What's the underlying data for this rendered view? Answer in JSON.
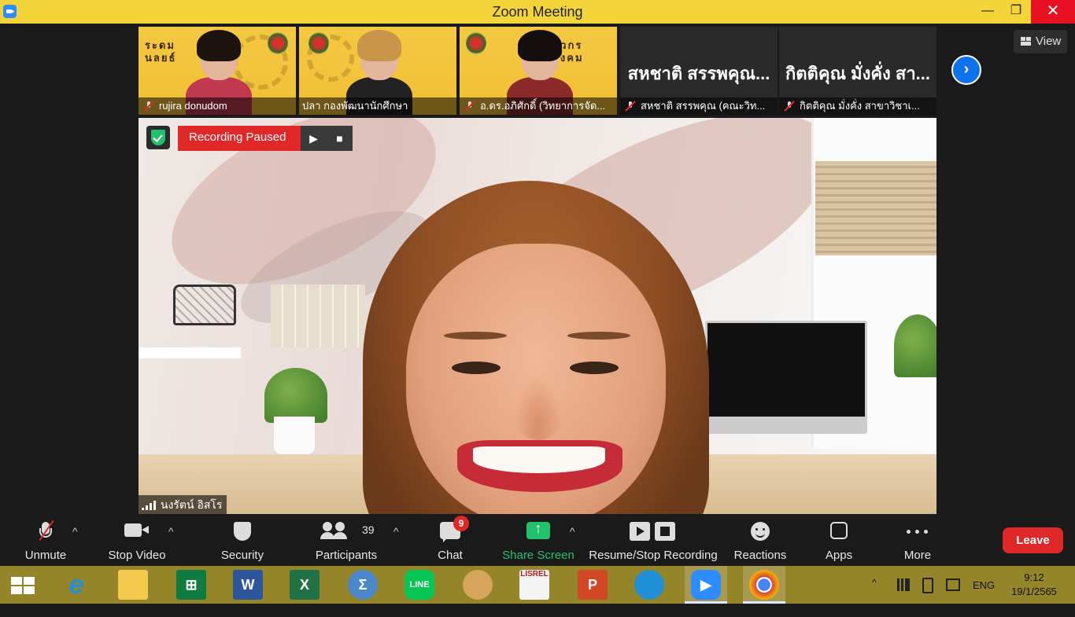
{
  "window": {
    "title": "Zoom Meeting",
    "minimize": "—",
    "maximize": "❐",
    "close": "✕"
  },
  "gallery": {
    "thumbnails": [
      {
        "name": "rujira donudom",
        "video": true,
        "muted": true,
        "text_top": "ระดม\nนลยธ์"
      },
      {
        "name": "ปลา กองพัฒนานักศึกษา",
        "video": true,
        "muted": false
      },
      {
        "name": "อ.ดร.อภิศักดิ์ (วิทยาการจัด...",
        "video": true,
        "muted": true,
        "text_top": "ศวกร\nสังคม"
      },
      {
        "name": "สหชาติ สรรพคุณ (คณะวิท...",
        "display_name": "สหชาติ สรรพคุณ...",
        "video": false,
        "muted": true
      },
      {
        "name": "กิตติคุณ  มั่งคั่ง สาขาวิชาเ...",
        "display_name": "กิตติคุณ  มั่งคั่ง สา...",
        "video": false,
        "muted": true
      }
    ],
    "next_icon": "›",
    "view_label": "View"
  },
  "recording": {
    "status": "Recording Paused",
    "play_icon": "▶",
    "stop_icon": "■"
  },
  "speaker": {
    "name": "นงรัตน์ อิสโร"
  },
  "toolbar": {
    "unmute": "Unmute",
    "stop_video": "Stop Video",
    "security": "Security",
    "participants": "Participants",
    "participants_count": "39",
    "chat": "Chat",
    "chat_badge": "9",
    "share_screen": "Share Screen",
    "recording": "Resume/Stop Recording",
    "reactions": "Reactions",
    "apps": "Apps",
    "more": "More",
    "leave": "Leave",
    "caret": "^",
    "accent_green": "#23c16b",
    "accent_red": "#e02828"
  },
  "taskbar": {
    "apps": [
      "start-icon",
      "internet-explorer-icon",
      "file-explorer-icon",
      "store-icon",
      "word-icon",
      "excel-icon",
      "math-icon",
      "line-icon",
      "paint-icon",
      "lisrel-icon",
      "powerpoint-icon",
      "edge-icon",
      "zoom-icon",
      "chrome-icon"
    ],
    "lisrel_label": "LISREL",
    "tray_language": "ENG",
    "clock_time": "9:12",
    "clock_date": "19/1/2565",
    "chevron": "^"
  }
}
